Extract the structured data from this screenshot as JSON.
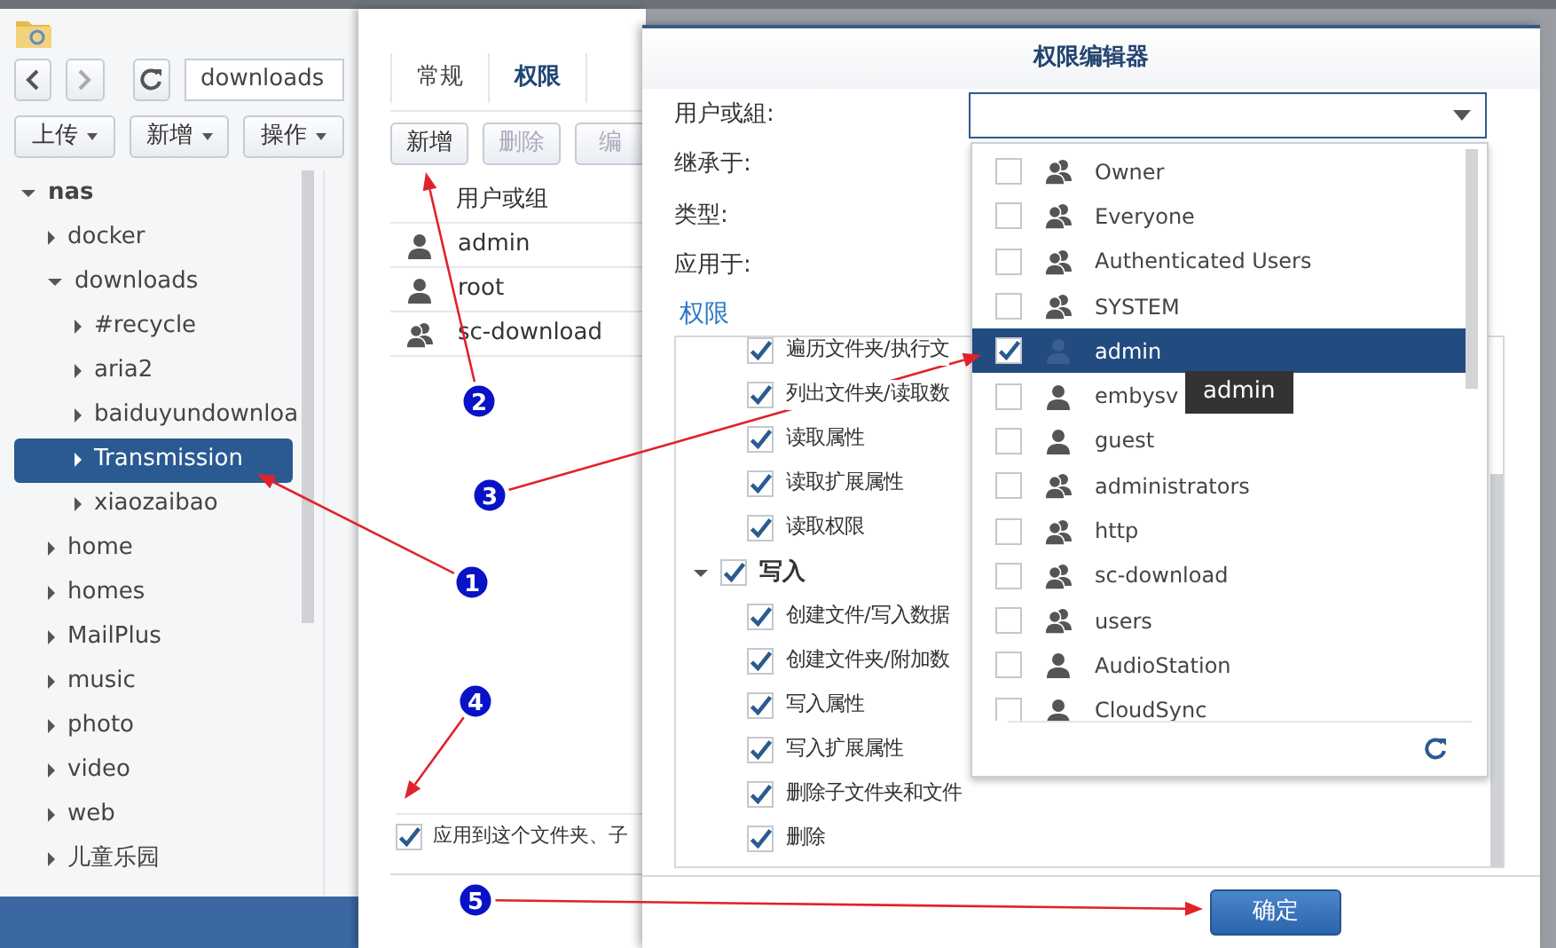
{
  "file_manager": {
    "path": "downloads",
    "toolbar": [
      {
        "label": "上传"
      },
      {
        "label": "新增"
      },
      {
        "label": "操作"
      }
    ],
    "tree": [
      {
        "label": "nas",
        "expanded": true,
        "selected": false,
        "children": [
          {
            "label": "docker",
            "expanded": false,
            "selected": false
          },
          {
            "label": "downloads",
            "expanded": true,
            "selected": false,
            "children": [
              {
                "label": "#recycle",
                "expanded": false,
                "selected": false
              },
              {
                "label": "aria2",
                "expanded": false,
                "selected": false
              },
              {
                "label": "baiduyundownloa",
                "expanded": false,
                "selected": false
              },
              {
                "label": "Transmission",
                "expanded": false,
                "selected": true
              },
              {
                "label": "xiaozaibao",
                "expanded": false,
                "selected": false
              }
            ]
          },
          {
            "label": "home",
            "expanded": false,
            "selected": false
          },
          {
            "label": "homes",
            "expanded": false,
            "selected": false
          },
          {
            "label": "MailPlus",
            "expanded": false,
            "selected": false
          },
          {
            "label": "music",
            "expanded": false,
            "selected": false
          },
          {
            "label": "photo",
            "expanded": false,
            "selected": false
          },
          {
            "label": "video",
            "expanded": false,
            "selected": false
          },
          {
            "label": "web",
            "expanded": false,
            "selected": false
          },
          {
            "label": "儿童乐园",
            "expanded": false,
            "selected": false
          }
        ]
      }
    ]
  },
  "properties": {
    "tabs": [
      {
        "label": "常规",
        "selected": false
      },
      {
        "label": "权限",
        "selected": true
      }
    ],
    "buttons": [
      {
        "label": "新增",
        "disabled": false
      },
      {
        "label": "删除",
        "disabled": true
      },
      {
        "label": "编",
        "disabled": true
      }
    ],
    "column": "用户或组",
    "rows": [
      {
        "name": "admin",
        "kind": "user"
      },
      {
        "name": "root",
        "kind": "user"
      },
      {
        "name": "sc-download",
        "kind": "group"
      }
    ],
    "apply_option": {
      "label": "应用到这个文件夹、子",
      "checked": true
    }
  },
  "editor": {
    "title": "权限编辑器",
    "fields": [
      {
        "label": "用户或組:"
      },
      {
        "label": "继承于:"
      },
      {
        "label": "类型:"
      },
      {
        "label": "应用于:"
      }
    ],
    "section": "权限",
    "permissions": [
      {
        "kind": "item",
        "label": "遍历文件夹/执行文",
        "checked": true
      },
      {
        "kind": "item",
        "label": "列出文件夹/读取数",
        "checked": true
      },
      {
        "kind": "item",
        "label": "读取属性",
        "checked": true
      },
      {
        "kind": "item",
        "label": "读取扩展属性",
        "checked": true
      },
      {
        "kind": "item",
        "label": "读取权限",
        "checked": true
      },
      {
        "kind": "group",
        "label": "写入",
        "checked": true,
        "expanded": true,
        "children": [
          {
            "kind": "item",
            "label": "创建文件/写入数据",
            "checked": true
          },
          {
            "kind": "item",
            "label": "创建文件夹/附加数",
            "checked": true
          },
          {
            "kind": "item",
            "label": "写入属性",
            "checked": true
          },
          {
            "kind": "item",
            "label": "写入扩展属性",
            "checked": true
          },
          {
            "kind": "item",
            "label": "删除子文件夹和文件",
            "checked": true
          },
          {
            "kind": "item",
            "label": "删除",
            "checked": true
          }
        ]
      }
    ],
    "confirm": "确定",
    "dropdown": {
      "options": [
        {
          "name": "Owner",
          "kind": "group",
          "checked": false,
          "selected": false
        },
        {
          "name": "Everyone",
          "kind": "group",
          "checked": false,
          "selected": false
        },
        {
          "name": "Authenticated Users",
          "kind": "group",
          "checked": false,
          "selected": false
        },
        {
          "name": "SYSTEM",
          "kind": "group",
          "checked": false,
          "selected": false
        },
        {
          "name": "admin",
          "kind": "user",
          "checked": true,
          "selected": true
        },
        {
          "name": "embysv",
          "kind": "user",
          "checked": false,
          "selected": false
        },
        {
          "name": "guest",
          "kind": "user",
          "checked": false,
          "selected": false
        },
        {
          "name": "administrators",
          "kind": "group",
          "checked": false,
          "selected": false
        },
        {
          "name": "http",
          "kind": "group",
          "checked": false,
          "selected": false
        },
        {
          "name": "sc-download",
          "kind": "group",
          "checked": false,
          "selected": false
        },
        {
          "name": "users",
          "kind": "group",
          "checked": false,
          "selected": false
        },
        {
          "name": "AudioStation",
          "kind": "user",
          "checked": false,
          "selected": false
        },
        {
          "name": "CloudSync",
          "kind": "user",
          "checked": false,
          "selected": false
        }
      ],
      "tooltip": "admin"
    }
  },
  "annotations": [
    {
      "label": "1"
    },
    {
      "label": "2"
    },
    {
      "label": "3"
    },
    {
      "label": "4"
    },
    {
      "label": "5"
    }
  ]
}
